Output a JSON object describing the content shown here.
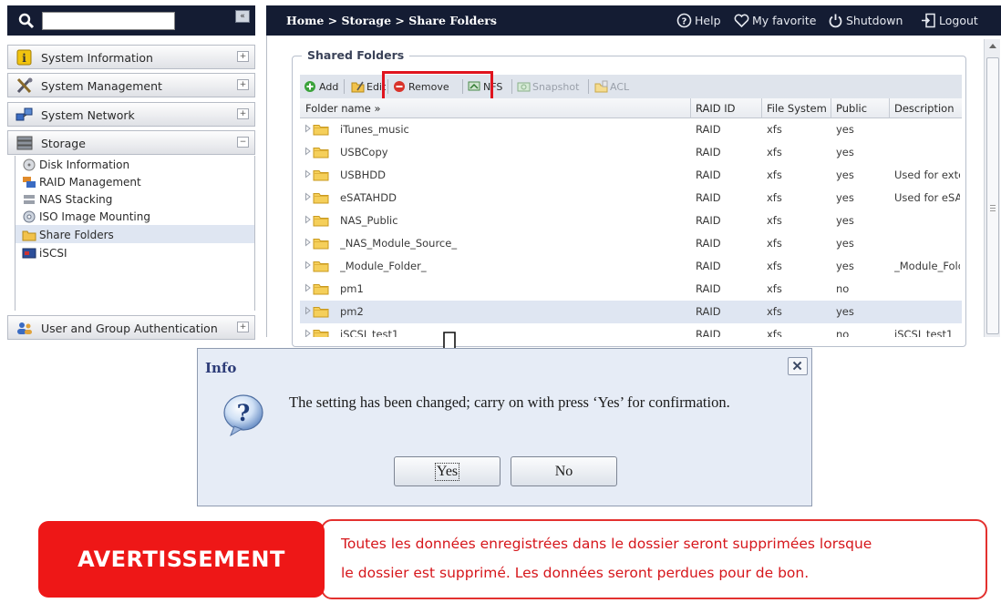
{
  "sidebar": {
    "search": {
      "value": "",
      "placeholder": ""
    },
    "collapse_glyph": "«",
    "sections": [
      {
        "label": "System Information",
        "toggle": "+"
      },
      {
        "label": "System Management",
        "toggle": "+"
      },
      {
        "label": "System Network",
        "toggle": "+"
      },
      {
        "label": "Storage",
        "toggle": "−"
      },
      {
        "label": "User and Group Authentication",
        "toggle": "+"
      }
    ],
    "storage_items": [
      {
        "label": "Disk Information"
      },
      {
        "label": "RAID Management"
      },
      {
        "label": "NAS Stacking"
      },
      {
        "label": "ISO Image Mounting"
      },
      {
        "label": "Share Folders",
        "active": true
      },
      {
        "label": "iSCSI"
      }
    ]
  },
  "header": {
    "breadcrumb": "Home > Storage > Share Folders",
    "links": {
      "help": "Help",
      "favorite": "My favorite",
      "shutdown": "Shutdown",
      "logout": "Logout"
    }
  },
  "main": {
    "group_title": "Shared Folders",
    "toolbar": {
      "add": "Add",
      "edit": "Edit",
      "remove": "Remove",
      "nfs": "NFS",
      "snapshot": "Snapshot",
      "acl": "ACL"
    },
    "columns": [
      "Folder name »",
      "RAID ID",
      "File System",
      "Public",
      "Description"
    ],
    "rows": [
      [
        "iTunes_music",
        "RAID",
        "xfs",
        "yes",
        ""
      ],
      [
        "USBCopy",
        "RAID",
        "xfs",
        "yes",
        ""
      ],
      [
        "USBHDD",
        "RAID",
        "xfs",
        "yes",
        "Used for exte"
      ],
      [
        "eSATAHDD",
        "RAID",
        "xfs",
        "yes",
        "Used for eSA"
      ],
      [
        "NAS_Public",
        "RAID",
        "xfs",
        "yes",
        ""
      ],
      [
        "_NAS_Module_Source_",
        "RAID",
        "xfs",
        "yes",
        ""
      ],
      [
        "_Module_Folder_",
        "RAID",
        "xfs",
        "yes",
        "_Module_Folc"
      ],
      [
        "pm1",
        "RAID",
        "xfs",
        "no",
        ""
      ],
      [
        "pm2",
        "RAID",
        "xfs",
        "yes",
        ""
      ],
      [
        "iSCSI_test1",
        "RAID",
        "xfs",
        "no",
        "iSCSI_test1"
      ]
    ],
    "selected_row": 8
  },
  "dialog": {
    "title": "Info",
    "message": "The setting has been changed; carry on with press ‘Yes’ for confirmation.",
    "yes": "Yes",
    "no": "No",
    "close_glyph": "✕"
  },
  "warning": {
    "label": "AVERTISSEMENT",
    "line1": "Toutes les données enregistrées dans le dossier seront supprimées lorsque",
    "line2": "le dossier est supprimé. Les données seront perdues pour de bon."
  },
  "colors": {
    "topbar": "#141c33",
    "highlight_red": "#e0141e",
    "warning_red": "#ee1717",
    "warning_text": "#d6161b",
    "dialog_bg": "#e6ecf6",
    "selected_row": "#dfe6f2"
  },
  "icons": {
    "search": "search-icon",
    "help": "help-icon",
    "favorite": "heart-icon",
    "shutdown": "power-icon",
    "logout": "logout-icon",
    "add": "add-icon",
    "edit": "edit-icon",
    "remove": "remove-icon",
    "nfs": "nfs-icon",
    "snapshot": "snapshot-icon",
    "acl": "acl-icon",
    "folder": "folder-icon",
    "question": "question-icon",
    "close": "close-icon",
    "arrow": "down-arrow-icon"
  }
}
